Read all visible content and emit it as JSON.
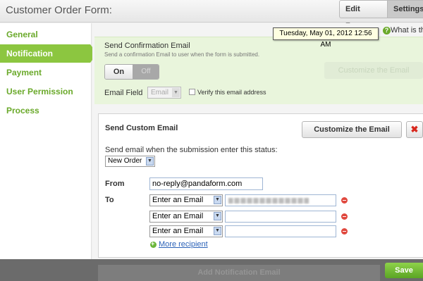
{
  "header": {
    "title": "Customer Order Form:",
    "edit_form": "Edit Form",
    "settings": "Settings"
  },
  "sidebar": {
    "items": [
      {
        "label": "General"
      },
      {
        "label": "Notification",
        "active": true
      },
      {
        "label": "Payment"
      },
      {
        "label": "User Permission"
      },
      {
        "label": "Process"
      }
    ]
  },
  "help": {
    "text": "What is this"
  },
  "tooltip": {
    "text": "Tuesday, May 01, 2012 12:56 AM"
  },
  "confirmation": {
    "title": "Send Confirmation Email",
    "description": "Send a confirmation Email to user when the form is submitted.",
    "on_label": "On",
    "off_label": "Off",
    "customize_label": "Customize the Email",
    "email_field_label": "Email Field",
    "email_field_value": "Email",
    "verify_label": "Verify this email address"
  },
  "custom_email": {
    "title": "Send Custom Email",
    "customize_label": "Customize the Email",
    "delete_label": "✖",
    "status_label": "Send email when the submission enter this status:",
    "status_value": "New Order",
    "from_label": "From",
    "from_value": "no-reply@pandaform.com",
    "to_label": "To",
    "recipients": [
      {
        "select": "Enter an Email"
      },
      {
        "select": "Enter an Email"
      },
      {
        "select": "Enter an Email"
      }
    ],
    "more_recipient": "More recipient"
  },
  "footer": {
    "add_notification": "Add Notification Email",
    "save": "Save"
  },
  "colors": {
    "accent": "#8cc640",
    "link": "#2b62b8",
    "danger": "#d8261c"
  }
}
